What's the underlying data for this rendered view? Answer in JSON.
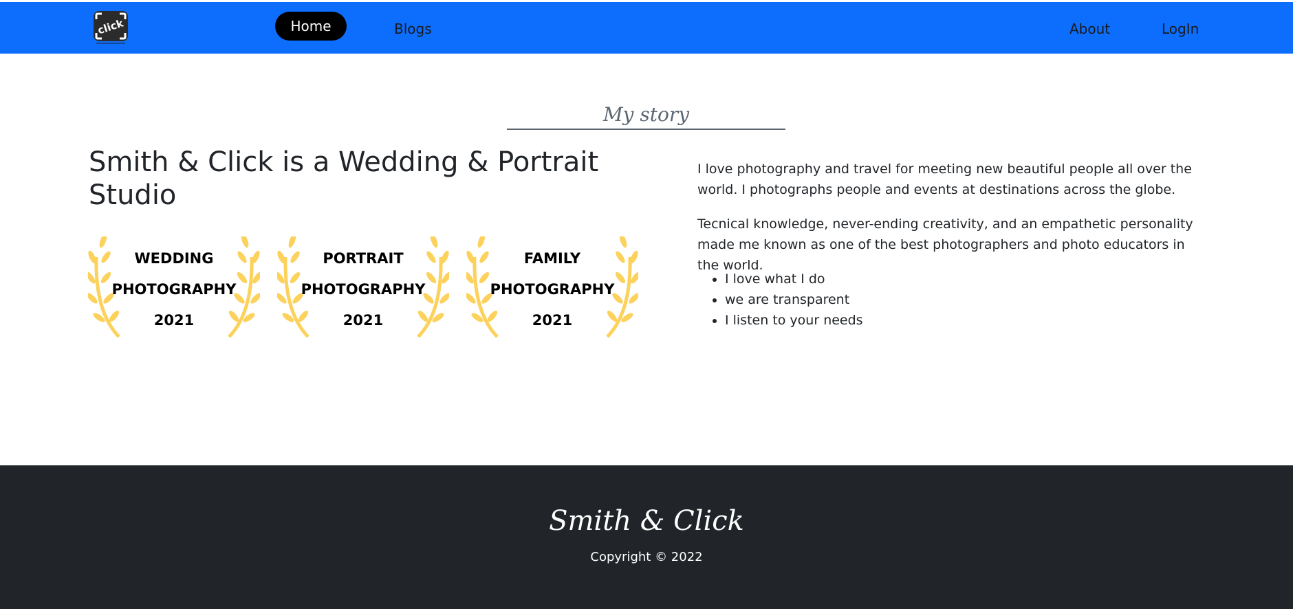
{
  "navbar": {
    "logo_text": "click",
    "items": [
      {
        "label": "Home"
      },
      {
        "label": "Blogs"
      },
      {
        "label": "About"
      },
      {
        "label": "LogIn"
      }
    ]
  },
  "story": {
    "section_title": "My story",
    "headline": "Smith & Click is a Wedding & Portrait Studio",
    "awards": [
      {
        "line1": "WEDDING",
        "line2": "PHOTOGRAPHY",
        "line3": "2021"
      },
      {
        "line1": "PORTRAIT",
        "line2": "PHOTOGRAPHY",
        "line3": "2021"
      },
      {
        "line1": "FAMILY",
        "line2": "PHOTOGRAPHY",
        "line3": "2021"
      }
    ],
    "paragraphs": [
      "I love photography and travel for meeting new beautiful people all over the world. I photographs people and events at destinations across the globe.",
      "Tecnical knowledge, never-ending creativity, and an empathetic personality made me known as one of the best photographers and photo educators in the world."
    ],
    "bullets": [
      "I love what I do",
      "we are transparent",
      "I listen to your needs"
    ]
  },
  "footer": {
    "brand": "Smith & Click",
    "copyright": "Copyright © 2022"
  },
  "colors": {
    "navbar": "#0d6efd",
    "footer": "#212529",
    "laurel": "#fcd15c",
    "active_nav": "#000000"
  }
}
